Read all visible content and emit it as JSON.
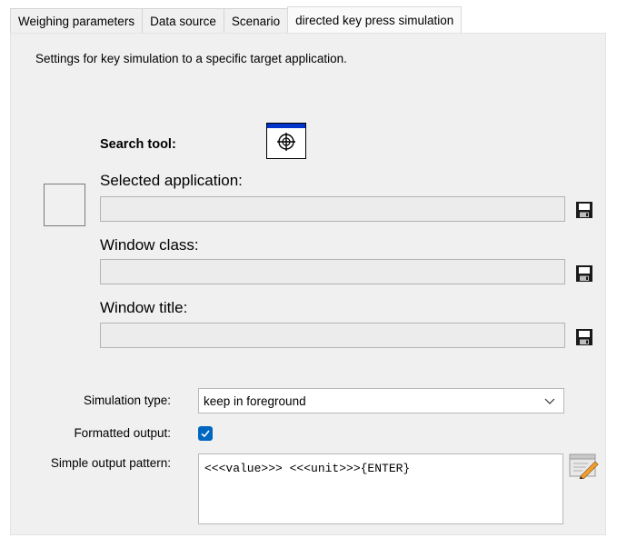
{
  "tabs": [
    {
      "label": "Weighing parameters"
    },
    {
      "label": "Data source"
    },
    {
      "label": "Scenario"
    },
    {
      "label": "directed key press simulation"
    }
  ],
  "active_tab": "directed key press simulation",
  "panel": {
    "description": "Settings for key simulation to a specific target application.",
    "search_tool_label": "Search tool:",
    "selected_application_label": "Selected application:",
    "selected_application_value": "",
    "window_class_label": "Window class:",
    "window_class_value": "",
    "window_title_label": "Window title:",
    "window_title_value": "",
    "simulation_type_label": "Simulation type:",
    "simulation_type_value": "keep in foreground",
    "formatted_output_label": "Formatted output:",
    "formatted_output_checked": true,
    "simple_output_pattern_label": "Simple output pattern:",
    "simple_output_pattern_value": "<<<value>>> <<<unit>>>{ENTER}"
  },
  "colors": {
    "accent": "#0067c0",
    "crosshair_bar": "#0033cc",
    "panel_bg": "#f0f0f0"
  },
  "icons": [
    "crosshair-icon",
    "save-icon",
    "chevron-down-icon",
    "checkmark-icon",
    "edit-pattern-icon"
  ]
}
